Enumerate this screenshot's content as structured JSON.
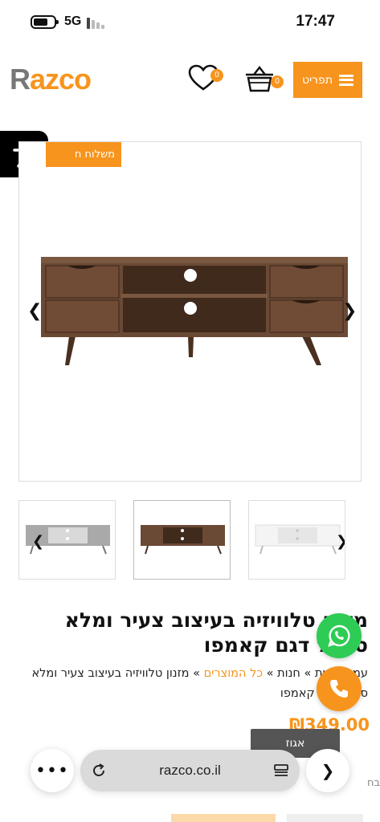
{
  "status_bar": {
    "network": "5G",
    "time": "17:47"
  },
  "header": {
    "logo_first": "R",
    "logo_rest": "azco",
    "wishlist_count": "0",
    "cart_count": "0",
    "menu_label": "תפריט"
  },
  "product": {
    "shipping_badge": "משלוח ח",
    "title": "מזנון טלוויזיה בעיצוב צעיר ומלא סטייל דגם קאמפו",
    "breadcrumb_home": "עמוד הבית",
    "breadcrumb_shop": "חנות",
    "breadcrumb_all": "כל המוצרים",
    "breadcrumb_current": "מזנון טלוויזיה בעיצוב צעיר ומלא סטייל דגם קאמפו",
    "breadcrumb_sep": " » ",
    "price": "₪349.00",
    "variant_button": "אגוז",
    "partial_label": "בח"
  },
  "thumbnails": [
    {
      "name": "gray",
      "color": "#a9a9a9"
    },
    {
      "name": "walnut",
      "color": "#6b4a35"
    },
    {
      "name": "white",
      "color": "#f4f4f4"
    }
  ],
  "browser": {
    "url": "razco.co.il"
  },
  "colors": {
    "accent": "#f7941d",
    "whatsapp": "#2ecc55"
  }
}
